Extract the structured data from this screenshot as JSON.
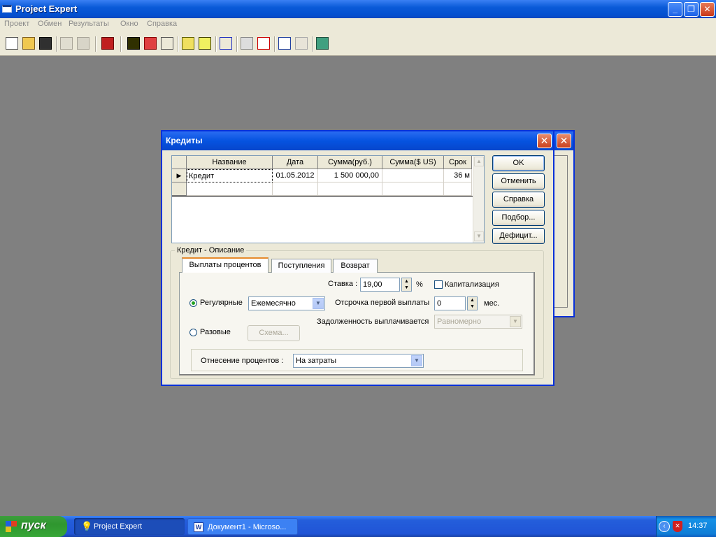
{
  "app": {
    "title": "Project Expert"
  },
  "menu": [
    "Проект",
    "Обмен",
    "Результаты",
    "Окно",
    "Справка"
  ],
  "dialog": {
    "title": "Кредиты",
    "grid": {
      "columns": [
        "Название",
        "Дата",
        "Сумма(руб.)",
        "Сумма($ US)",
        "Срок"
      ],
      "rows": [
        {
          "name": "Кредит",
          "date": "01.05.2012",
          "sum_rub": "1 500 000,00",
          "sum_usd": "",
          "term": "36 м"
        }
      ]
    },
    "buttons": {
      "ok": "OK",
      "cancel": "Отменить",
      "help": "Справка",
      "select": "Подбор...",
      "deficit": "Дефицит..."
    },
    "group_title": "Кредит - Описание",
    "tabs": [
      "Выплаты процентов",
      "Поступления",
      "Возврат"
    ],
    "rate_label": "Ставка :",
    "rate_value": "19,00",
    "rate_unit": "%",
    "capitalization_label": "Капитализация",
    "regular_label": "Регулярные",
    "regular_value": "Ежемесячно",
    "delay_label": "Отсрочка первой выплаты",
    "delay_value": "0",
    "delay_unit": "мес.",
    "debt_label": "Задолженность выплачивается",
    "debt_value": "Равномерно",
    "onetime_label": "Разовые",
    "scheme_button": "Схема...",
    "interest_alloc_label": "Отнесение процентов :",
    "interest_alloc_value": "На затраты"
  },
  "taskbar": {
    "start": "пуск",
    "tasks": [
      "Project Expert",
      "Документ1 - Microso..."
    ],
    "clock": "14:37"
  }
}
